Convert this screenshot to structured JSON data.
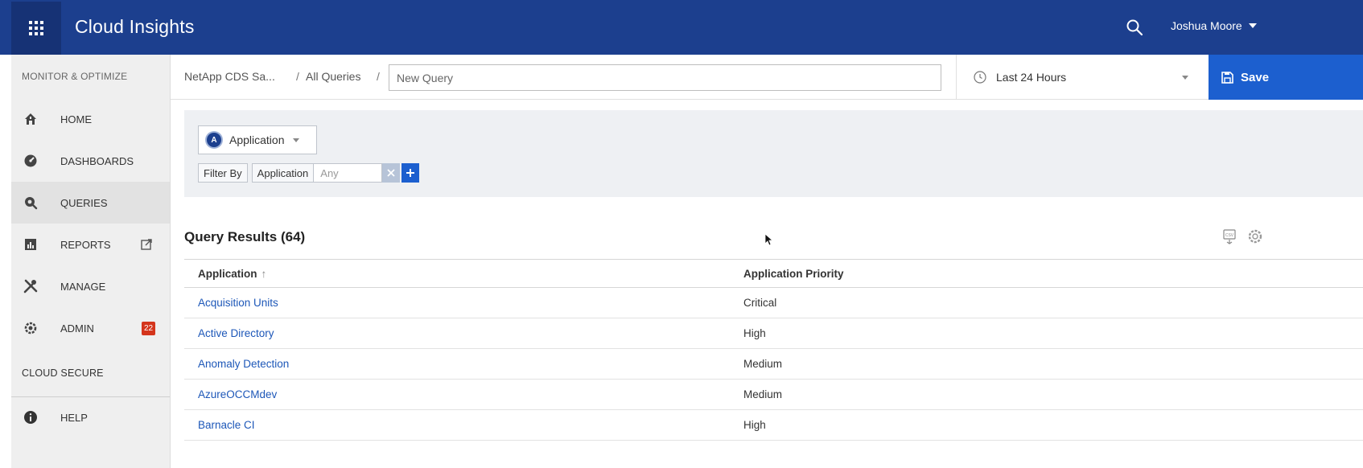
{
  "header": {
    "app_title": "Cloud Insights",
    "user_name": "Joshua Moore",
    "apps_icon": "grid-icon",
    "search_icon": "search-icon",
    "brand_color": "#1c3f8e"
  },
  "sidebar": {
    "section_top": "MONITOR & OPTIMIZE",
    "items": [
      {
        "label": "HOME",
        "icon": "home-icon"
      },
      {
        "label": "DASHBOARDS",
        "icon": "dashboard-icon"
      },
      {
        "label": "QUERIES",
        "icon": "query-icon",
        "active": true
      },
      {
        "label": "REPORTS",
        "icon": "reports-icon"
      },
      {
        "label": "MANAGE",
        "icon": "tools-icon"
      },
      {
        "label": "ADMIN",
        "icon": "gear-icon",
        "badge": "22"
      }
    ],
    "section_bottom": "CLOUD SECURE",
    "help_label": "HELP"
  },
  "querybar": {
    "breadcrumb_root": "NetApp CDS Sa...",
    "breadcrumb_sep": "/",
    "breadcrumb_queries": "All Queries",
    "query_name_placeholder": "New Query",
    "time_range": "Last 24 Hours",
    "save_label": "Save"
  },
  "filter": {
    "object_badge": "A",
    "object_type": "Application",
    "filter_by_label": "Filter By",
    "filter_field": "Application",
    "filter_value": "Any"
  },
  "results": {
    "title": "Query Results (64)",
    "columns": [
      "Application",
      "Application Priority"
    ],
    "sort_indicator": "↑",
    "rows": [
      {
        "application": "Acquisition Units",
        "priority": "Critical"
      },
      {
        "application": "Active Directory",
        "priority": "High"
      },
      {
        "application": "Anomaly Detection",
        "priority": "Medium"
      },
      {
        "application": "AzureOCCMdev",
        "priority": "Medium"
      },
      {
        "application": "Barnacle CI",
        "priority": "High"
      }
    ]
  }
}
